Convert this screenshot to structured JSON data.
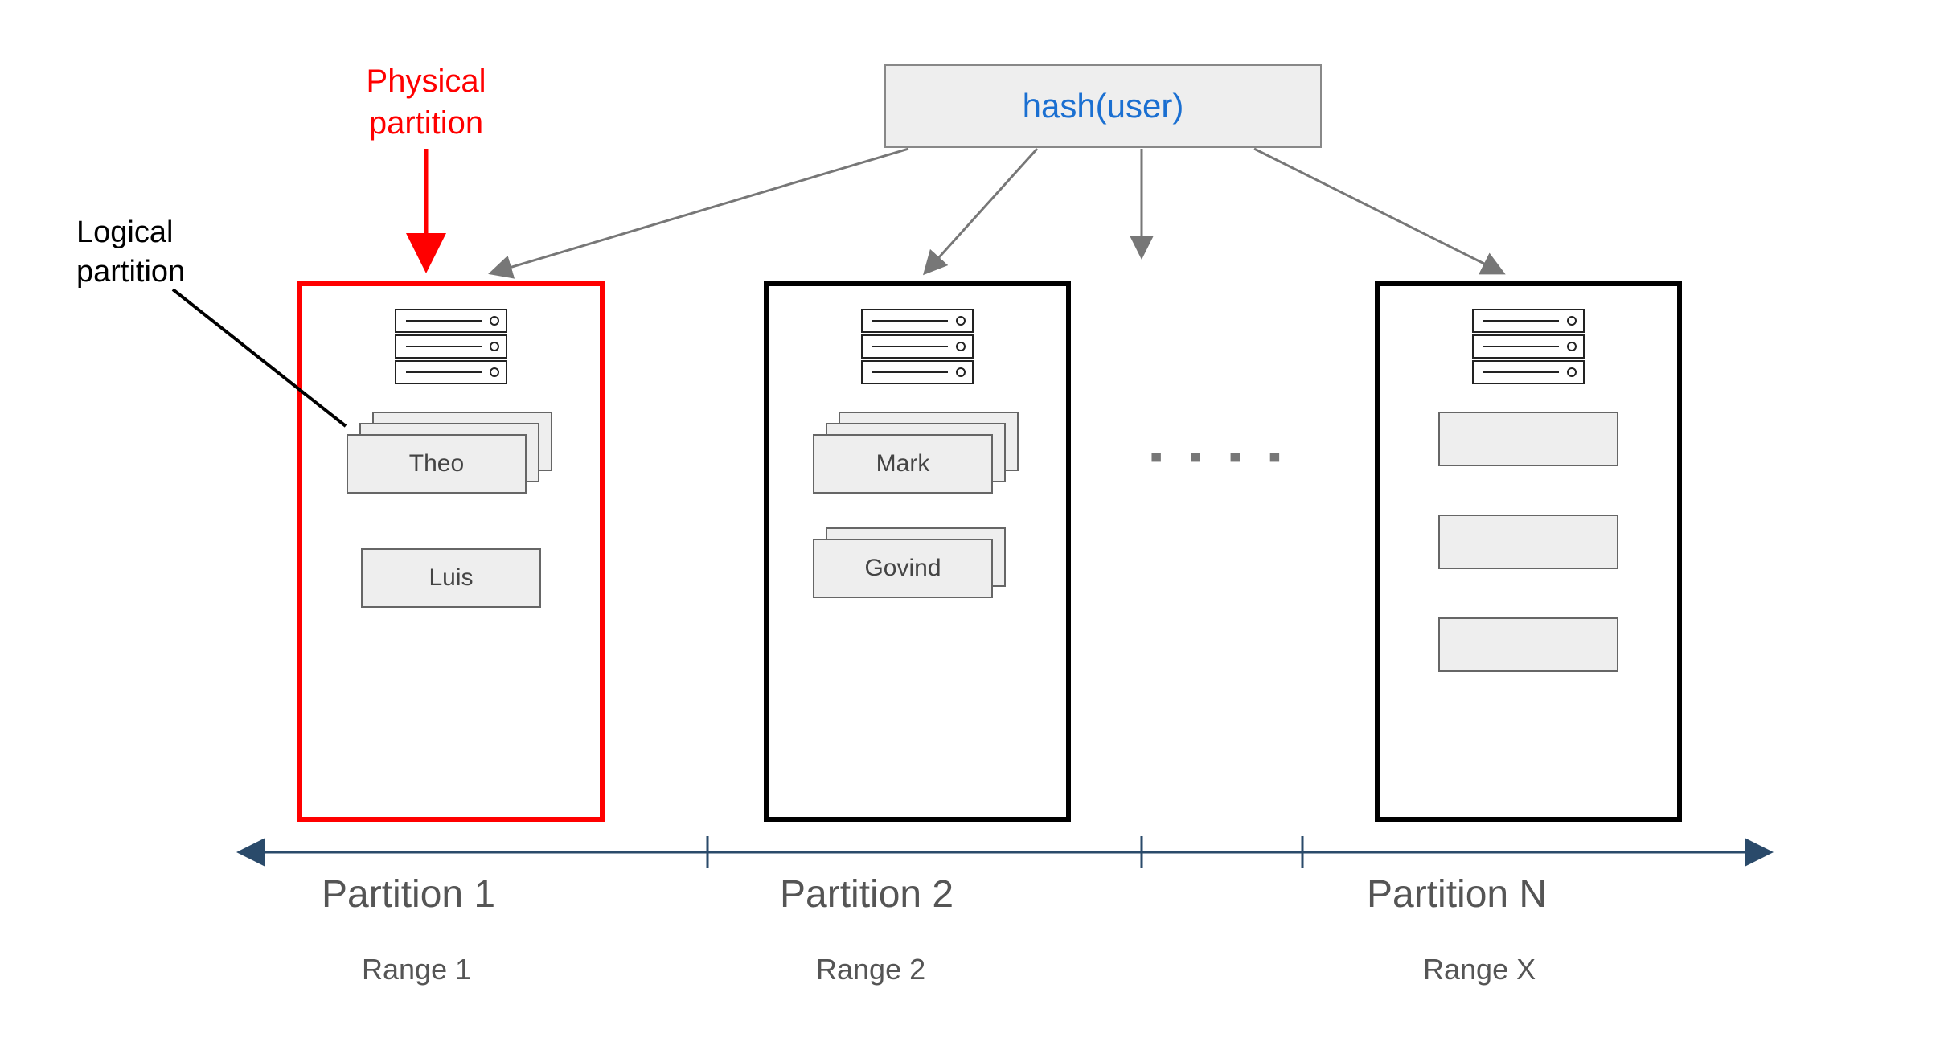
{
  "hash_label": "hash(user)",
  "annotations": {
    "physical_partition": "Physical\npartition",
    "logical_partition": "Logical\npartition"
  },
  "partitions": [
    {
      "title": "Partition 1",
      "range": "Range 1",
      "highlight_color": "#ff0000",
      "logical_partitions": [
        {
          "label": "Theo",
          "stacked": true
        },
        {
          "label": "Luis",
          "stacked": false
        }
      ]
    },
    {
      "title": "Partition 2",
      "range": "Range 2",
      "highlight_color": "#000000",
      "logical_partitions": [
        {
          "label": "Mark",
          "stacked": true
        },
        {
          "label": "Govind",
          "stacked": true
        }
      ]
    },
    {
      "title": "Partition N",
      "range": "Range X",
      "highlight_color": "#000000",
      "logical_partitions": [
        {
          "label": "",
          "stacked": false
        },
        {
          "label": "",
          "stacked": false
        },
        {
          "label": "",
          "stacked": false
        }
      ]
    }
  ],
  "ellipsis": "▪ ▪ ▪ ▪"
}
